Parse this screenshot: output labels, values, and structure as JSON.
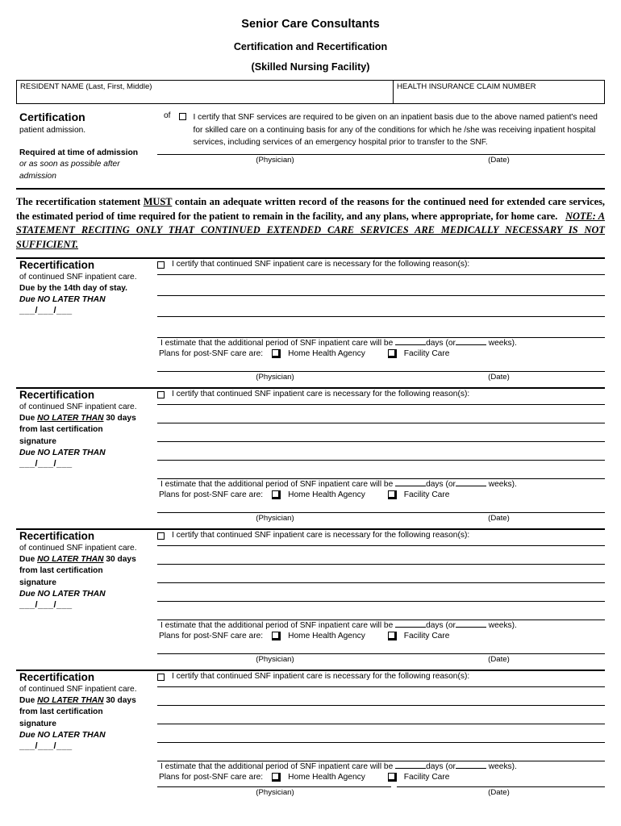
{
  "header": {
    "organization": "Senior Care Consultants",
    "title": "Certification and Recertification",
    "subtitle": "(Skilled Nursing Facility)"
  },
  "identification": {
    "resident_name_label": "RESIDENT NAME (Last, First, Middle)",
    "resident_name_value": "",
    "claim_number_label": "HEALTH INSURANCE CLAIM NUMBER",
    "claim_number_value": ""
  },
  "certification": {
    "heading": "Certification",
    "subheading": "patient admission.",
    "of_label": "of",
    "body": "I certify that SNF services are required to be given on an inpatient basis due to the above named patient's need for skilled care on a continuing basis for any of the conditions for which he /she was receiving inpatient hospital services, including services of an emergency hospital prior to transfer to the SNF.",
    "required_label": "Required at time of admission",
    "required_note": "or as soon as possible after admission",
    "physician_caption": "(Physician)",
    "date_caption": "(Date)"
  },
  "notice": {
    "part1": "The recertification statement ",
    "must": "MUST",
    "part2": " contain an adequate written record of the reasons for the continued need for extended care services, the estimated period of time required for the patient to remain in the facility, and any plans, where appropriate, for home care.   ",
    "note": "NOTE: A STATEMENT RECITING ONLY THAT CONTINUED EXTENDED CARE SERVICES ARE MEDICALLY NECESSARY IS NOT SUFFICIENT."
  },
  "shared": {
    "recert_heading": "Recertification",
    "recert_sub": "of continued SNF inpatient care.",
    "certify_text": "I certify that continued SNF inpatient care is necessary for the following reason(s):",
    "estimate_pre": "I estimate that the additional period of SNF inpatient care will be",
    "estimate_mid": "days (or",
    "estimate_post": "weeks).",
    "plans_label": "Plans for post-SNF care are:",
    "option_home_health": "Home Health Agency",
    "option_facility_care": "Facility Care",
    "due_no_later_than": "Due NO LATER THAN",
    "due_date_blank": "___/___/___",
    "physician_caption": "(Physician)",
    "date_caption": "(Date)",
    "days_value": "",
    "weeks_value": ""
  },
  "recertifications": [
    {
      "due_text_plain": "Due by the 14th day of stay.",
      "due_prefix": "",
      "due_emphasis": "",
      "due_suffix": "",
      "due_extra_1": "",
      "due_extra_2": "",
      "lines": 3,
      "split_signature": false
    },
    {
      "due_text_plain": "",
      "due_prefix": "Due ",
      "due_emphasis": "NO LATER THAN",
      "due_suffix": " 30 days",
      "due_extra_1": "from last certification",
      "due_extra_2": "signature",
      "lines": 4,
      "split_signature": false
    },
    {
      "due_text_plain": "",
      "due_prefix": "Due ",
      "due_emphasis": "NO LATER THAN",
      "due_suffix": " 30 days",
      "due_extra_1": "from last certification",
      "due_extra_2": "signature",
      "lines": 4,
      "split_signature": false
    },
    {
      "due_text_plain": "",
      "due_prefix": "Due ",
      "due_emphasis": "NO LATER THAN",
      "due_suffix": " 30 days",
      "due_extra_1": "from last certification",
      "due_extra_2": "signature",
      "lines": 4,
      "split_signature": true
    }
  ]
}
